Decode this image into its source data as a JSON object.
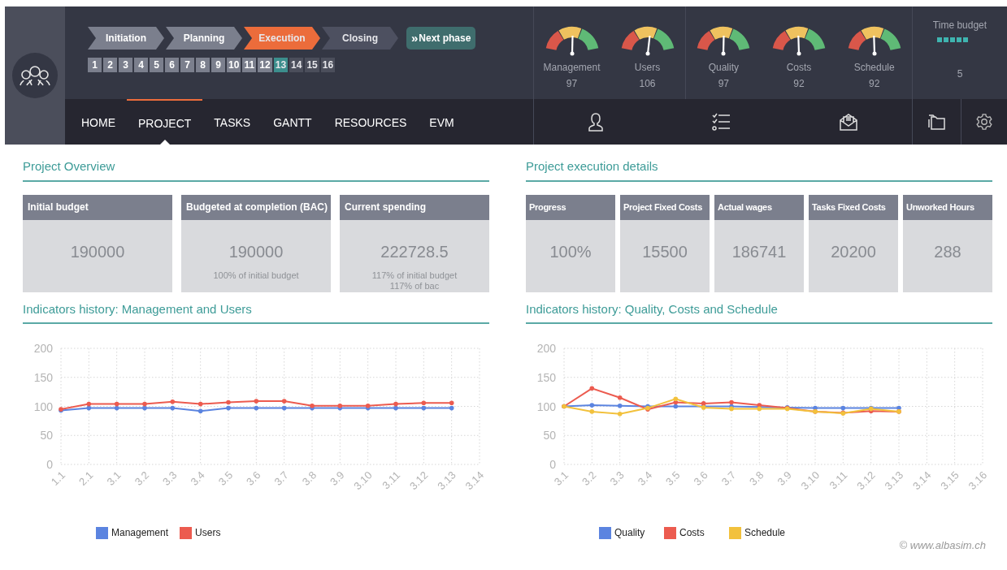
{
  "phases": [
    {
      "label": "Initiation",
      "done": true,
      "selected": false
    },
    {
      "label": "Planning",
      "done": true,
      "selected": false
    },
    {
      "label": "Execution",
      "done": false,
      "selected": true
    },
    {
      "label": "Closing",
      "done": false,
      "selected": false
    }
  ],
  "next_phase_button": {
    "icon": "»",
    "label": "Next phase"
  },
  "steps": [
    {
      "label": "1",
      "done": true,
      "selected": false
    },
    {
      "label": "2",
      "done": true,
      "selected": false
    },
    {
      "label": "3",
      "done": true,
      "selected": false
    },
    {
      "label": "4",
      "done": true,
      "selected": false
    },
    {
      "label": "5",
      "done": true,
      "selected": false
    },
    {
      "label": "6",
      "done": true,
      "selected": false
    },
    {
      "label": "7",
      "done": true,
      "selected": false
    },
    {
      "label": "8",
      "done": true,
      "selected": false
    },
    {
      "label": "9",
      "done": true,
      "selected": false
    },
    {
      "label": "10",
      "done": true,
      "selected": false
    },
    {
      "label": "11",
      "done": true,
      "selected": false
    },
    {
      "label": "12",
      "done": true,
      "selected": false
    },
    {
      "label": "13",
      "done": false,
      "selected": true
    },
    {
      "label": "14",
      "done": false,
      "selected": false
    },
    {
      "label": "15",
      "done": false,
      "selected": false
    },
    {
      "label": "16",
      "done": false,
      "selected": false
    }
  ],
  "nav_tabs": [
    {
      "label": "HOME",
      "selected": false
    },
    {
      "label": "PROJECT",
      "selected": true
    },
    {
      "label": "TASKS",
      "selected": false
    },
    {
      "label": "GANTT",
      "selected": false
    },
    {
      "label": "RESOURCES",
      "selected": false
    },
    {
      "label": "EVM",
      "selected": false
    }
  ],
  "gauge_groups": [
    [
      {
        "label": "Management",
        "value": "97"
      },
      {
        "label": "Users",
        "value": "106"
      }
    ],
    [
      {
        "label": "Quality",
        "value": "97"
      },
      {
        "label": "Costs",
        "value": "92"
      },
      {
        "label": "Schedule",
        "value": "92"
      }
    ]
  ],
  "time_budget": {
    "label": "Time budget",
    "value": "5"
  },
  "overview": {
    "title": "Project Overview",
    "cards": [
      {
        "title": "Initial budget",
        "value": "190000"
      },
      {
        "title": "Budgeted at completion (BAC)",
        "value": "190000",
        "notes": [
          "100% of initial budget"
        ]
      },
      {
        "title": "Current spending",
        "value": "222728.5",
        "notes": [
          "117% of initial budget",
          "117% of bac"
        ]
      }
    ]
  },
  "execution": {
    "title": "Project execution details",
    "cards": [
      {
        "title": "Progress",
        "value": "100%"
      },
      {
        "title": "Project Fixed Costs",
        "value": "15500"
      },
      {
        "title": "Actual wages",
        "value": "186741"
      },
      {
        "title": "Tasks Fixed Costs",
        "value": "20200"
      },
      {
        "title": "Unworked Hours",
        "value": "288"
      }
    ]
  },
  "charts": [
    {
      "title": "Indicators history: Management and Users",
      "chart_data": {
        "type": "line",
        "grid": true,
        "legend": "bottom",
        "categories": [
          "1.1",
          "2.1",
          "3.1",
          "3.2",
          "3.3",
          "3.4",
          "3.5",
          "3.6",
          "3.7",
          "3.8",
          "3.9",
          "3.10",
          "3.11",
          "3.12",
          "3.13",
          "3.14"
        ],
        "ylim": [
          0,
          200
        ],
        "yticks": [
          0,
          50,
          100,
          150,
          200
        ],
        "series": [
          {
            "name": "Management",
            "color": "#5b84e0",
            "values": [
              93,
              97,
              97,
              97,
              97,
              92,
              97,
              97,
              97,
              97,
              97,
              97,
              97,
              97,
              97,
              null
            ]
          },
          {
            "name": "Users",
            "color": "#ec5b4f",
            "values": [
              95,
              104,
              104,
              104,
              108,
              104,
              107,
              109,
              109,
              101,
              101,
              101,
              104,
              106,
              106,
              null
            ]
          }
        ]
      }
    },
    {
      "title": "Indicators history: Quality, Costs and Schedule",
      "chart_data": {
        "type": "line",
        "grid": true,
        "legend": "bottom",
        "categories": [
          "3.1",
          "3.2",
          "3.3",
          "3.4",
          "3.5",
          "3.6",
          "3.7",
          "3.8",
          "3.9",
          "3.10",
          "3.11",
          "3.12",
          "3.13",
          "3.14",
          "3.15",
          "3.16"
        ],
        "ylim": [
          0,
          200
        ],
        "yticks": [
          0,
          50,
          100,
          150,
          200
        ],
        "series": [
          {
            "name": "Quality",
            "color": "#5b84e0",
            "values": [
              100,
              102,
              101,
              100,
              100,
              100,
              100,
              99,
              98,
              97,
              97,
              97,
              97,
              null,
              null,
              null
            ]
          },
          {
            "name": "Costs",
            "color": "#ec5b4f",
            "values": [
              100,
              131,
              115,
              95,
              107,
              105,
              107,
              102,
              97,
              91,
              89,
              92,
              91,
              null,
              null,
              null
            ]
          },
          {
            "name": "Schedule",
            "color": "#f2c13c",
            "values": [
              100,
              91,
              87,
              97,
              113,
              98,
              96,
              96,
              96,
              91,
              88,
              96,
              91,
              null,
              null,
              null
            ]
          }
        ]
      }
    }
  ],
  "footer": "© www.albasim.ch"
}
